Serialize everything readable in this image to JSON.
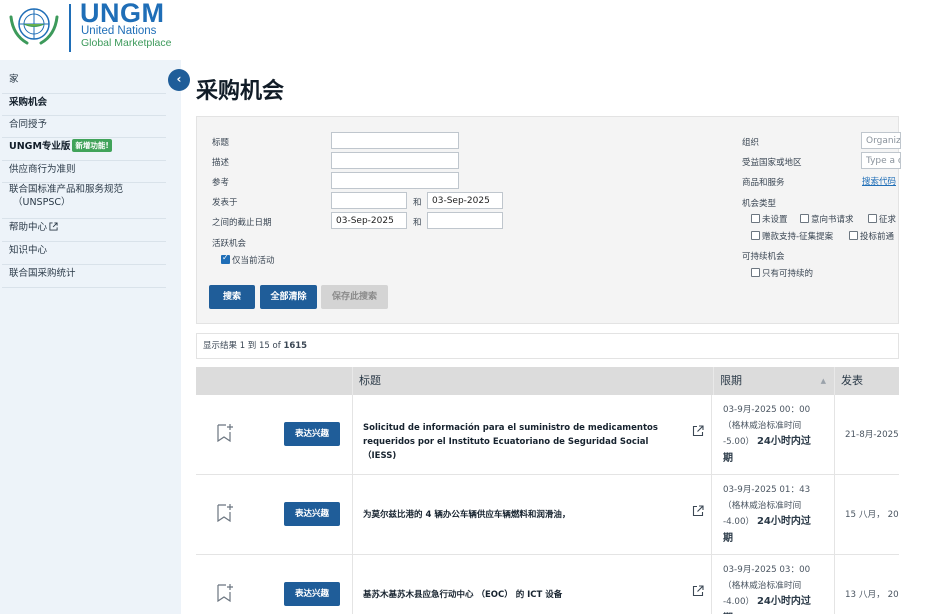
{
  "logo": {
    "brand": "UNGM",
    "line1": "United Nations",
    "line2": "Global Marketplace"
  },
  "sidebar": {
    "items": [
      {
        "label": "家"
      },
      {
        "label": "采购机会"
      },
      {
        "label": "合同授予"
      },
      {
        "label": "UNGM专业版",
        "badge": "新增功能!"
      },
      {
        "label": "供应商行为准则"
      },
      {
        "label": "联合国标准产品和服务规范",
        "label2": "（UNSPSC）"
      },
      {
        "label": "帮助中心"
      },
      {
        "label": "知识中心"
      },
      {
        "label": "联合国采购统计"
      }
    ],
    "collapse_icon": "‹"
  },
  "main": {
    "title": "采购机会"
  },
  "search": {
    "title_label": "标题",
    "desc_label": "描述",
    "ref_label": "参考",
    "published_label": "发表于",
    "and_label": "和",
    "published_to": "03-Sep-2025",
    "deadline_label": "之间的截止日期",
    "deadline_from": "03-Sep-2025",
    "active_label": "活跃机会",
    "active_only_label": "仅当前活动",
    "org_label": "组织",
    "org_placeholder": "Organiz",
    "country_label": "受益国家或地区",
    "country_placeholder": "Type a c",
    "goods_label": "商品和服务",
    "search_code_link": "搜索代码",
    "type_label": "机会类型",
    "type_options": [
      "未设置",
      "意向书请求",
      "征求",
      "赠款支持-征集提案",
      "投标前通"
    ],
    "sustainable_label": "可持续机会",
    "sustainable_only_label": "只有可持续的",
    "btn_search": "搜索",
    "btn_clear": "全部清除",
    "btn_save": "保存此搜索"
  },
  "results": {
    "prefix": "显示结果 1 到 15 of ",
    "total": "1615"
  },
  "table": {
    "col_title": "标题",
    "col_deadline": "限期",
    "col_published": "发表",
    "express_label": "表达兴趣",
    "rows": [
      {
        "title": "Solicitud de información para el suministro de medicamentos requeridos por el Instituto Ecuatoriano de Seguridad Social （IESS)",
        "deadline_line1": "03-9月-2025 00：00",
        "deadline_line2": "（格林威治标准时间",
        "deadline_line3": "-5.00）",
        "deadline_flag": "24小时内过",
        "deadline_flag2": "期",
        "published": "21-8月-2025"
      },
      {
        "title": "为莫尔兹比港的 4 辆办公车辆供应车辆燃料和润滑油，",
        "deadline_line1": "03-9月-2025 01：43",
        "deadline_line2": "（格林威治标准时间",
        "deadline_line3": "-4.00）",
        "deadline_flag": "24小时内过",
        "deadline_flag2": "期",
        "published": "15 八月， 20"
      },
      {
        "title": "基苏木基苏木县应急行动中心 （EOC） 的 ICT 设备",
        "deadline_line1": "03-9月-2025 03：00",
        "deadline_line2": "（格林威治标准时间",
        "deadline_line3": "-4.00）",
        "deadline_flag": "24小时内过",
        "deadline_flag2": "期",
        "published": "13 八月， 20"
      }
    ]
  },
  "icons": {
    "bookmark": "bookmark-add-icon",
    "external": "external-link-icon",
    "help_external": "external-link-icon"
  },
  "colors": {
    "primary": "#1f5d99",
    "brand_blue": "#1f6eb7",
    "badge_green": "#41a35a",
    "sidebar_bg": "#edf3f9"
  }
}
